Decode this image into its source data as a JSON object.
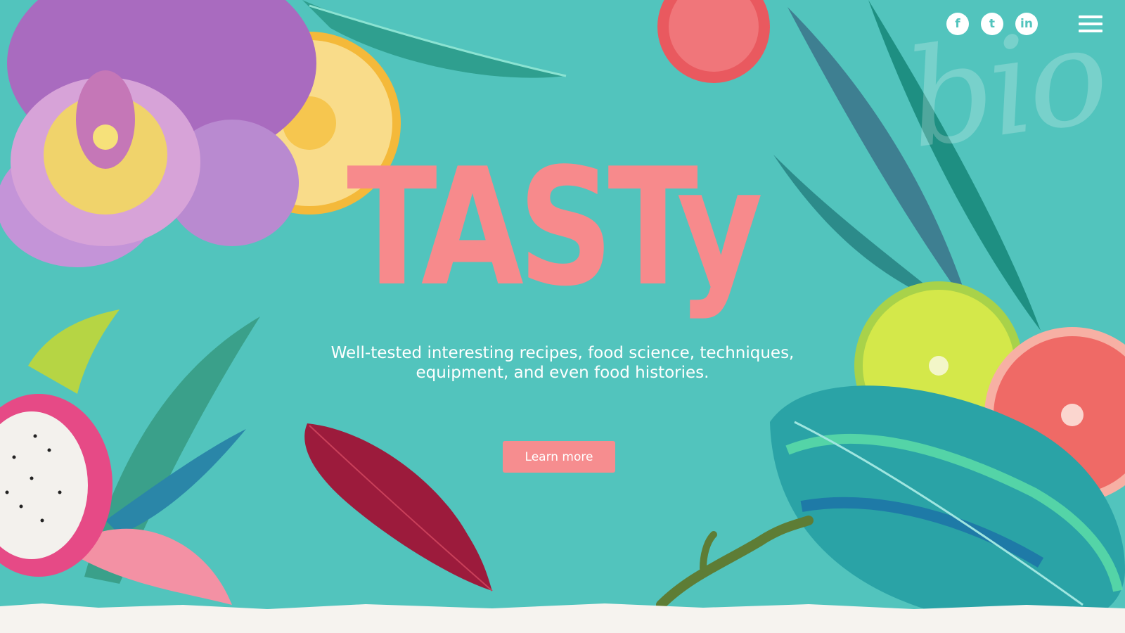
{
  "header": {
    "watermark": "bio",
    "social": [
      {
        "label": "f",
        "icon": "facebook-icon"
      },
      {
        "label": "t",
        "icon": "twitter-icon"
      },
      {
        "label": "in",
        "icon": "linkedin-icon"
      }
    ],
    "menu_icon": "hamburger-menu-icon"
  },
  "hero": {
    "title": "TASTy",
    "subtitle_line1": "Well-tested interesting recipes, food science, techniques,",
    "subtitle_line2": "equipment, and even food histories.",
    "cta_label": "Learn more"
  },
  "colors": {
    "background": "#52c4bd",
    "accent": "#f78a8c",
    "text": "#ffffff",
    "paper": "#f6f3ef"
  },
  "decorations": [
    "orchid-flower",
    "pineapple-slice",
    "lychee",
    "teal-leaf",
    "dragon-fruit",
    "red-leaf",
    "twig",
    "lime-slice",
    "grapefruit-slice",
    "blue-leaf"
  ]
}
